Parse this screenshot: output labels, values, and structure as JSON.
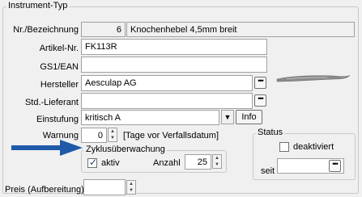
{
  "group": {
    "title": "Instrument-Typ"
  },
  "fields": {
    "nr_label": "Nr./Bezeichnung",
    "nr_value": "6",
    "name_value": "Knochenhebel 4,5mm breit",
    "artikel_label": "Artikel-Nr.",
    "artikel_value": "FK113R",
    "gs1_label": "GS1/EAN",
    "gs1_value": "",
    "hersteller_label": "Hersteller",
    "hersteller_value": "Aesculap AG",
    "lieferant_label": "Std.-Lieferant",
    "lieferant_value": "",
    "einstufung_label": "Einstufung",
    "einstufung_value": "kritisch A",
    "info_label": "Info",
    "warnung_label": "Warnung",
    "warnung_value": "0",
    "warnung_unit": "[Tage vor Verfallsdatum]",
    "preis_label": "Preis (Aufbereitung)",
    "preis_value": ""
  },
  "zyklus": {
    "title": "Zyklusüberwachung",
    "aktiv_label": "aktiv",
    "aktiv_checked": true,
    "anzahl_label": "Anzahl",
    "anzahl_value": "25"
  },
  "status": {
    "title": "Status",
    "deaktiviert_label": "deaktiviert",
    "deaktiviert_checked": false,
    "seit_label": "seit",
    "seit_value": ""
  },
  "browse_glyph": "•••",
  "colors": {
    "arrow": "#1f5aa8"
  }
}
